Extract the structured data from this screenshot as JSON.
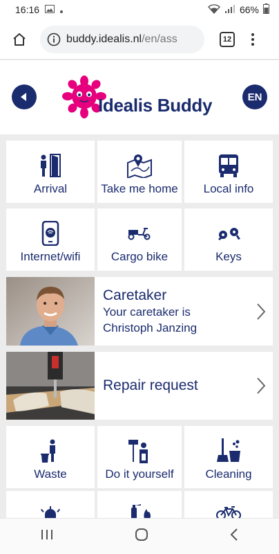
{
  "status_bar": {
    "time": "16:16",
    "battery": "66%"
  },
  "browser": {
    "url_host": "buddy.idealis.nl",
    "url_path": "/en/ass",
    "tab_count": "12"
  },
  "header": {
    "brand_name": "Idealis Buddy",
    "lang": "EN"
  },
  "tiles_row1": [
    {
      "label": "Arrival",
      "icon": "door-person-icon"
    },
    {
      "label": "Take me home",
      "icon": "map-pin-icon"
    },
    {
      "label": "Local info",
      "icon": "bus-icon"
    }
  ],
  "tiles_row2": [
    {
      "label": "Internet/wifi",
      "icon": "phone-wifi-icon"
    },
    {
      "label": "Cargo bike",
      "icon": "cargo-bike-icon"
    },
    {
      "label": "Keys",
      "icon": "keys-icon"
    }
  ],
  "caretaker": {
    "title": "Caretaker",
    "line1": "Your caretaker is",
    "line2": "Christoph Janzing"
  },
  "repair": {
    "title": "Repair request"
  },
  "tiles_row3": [
    {
      "label": "Waste",
      "icon": "waste-icon"
    },
    {
      "label": "Do it yourself",
      "icon": "diy-icon"
    },
    {
      "label": "Cleaning",
      "icon": "cleaning-icon"
    }
  ],
  "tiles_row4": [
    {
      "label": "",
      "icon": "alarm-light-icon"
    },
    {
      "label": "",
      "icon": "fire-extinguisher-icon"
    },
    {
      "label": "",
      "icon": "bicycle-icon"
    }
  ],
  "colors": {
    "brand_navy": "#1a2b6e",
    "brand_pink": "#e6007e",
    "background": "#ececec"
  }
}
